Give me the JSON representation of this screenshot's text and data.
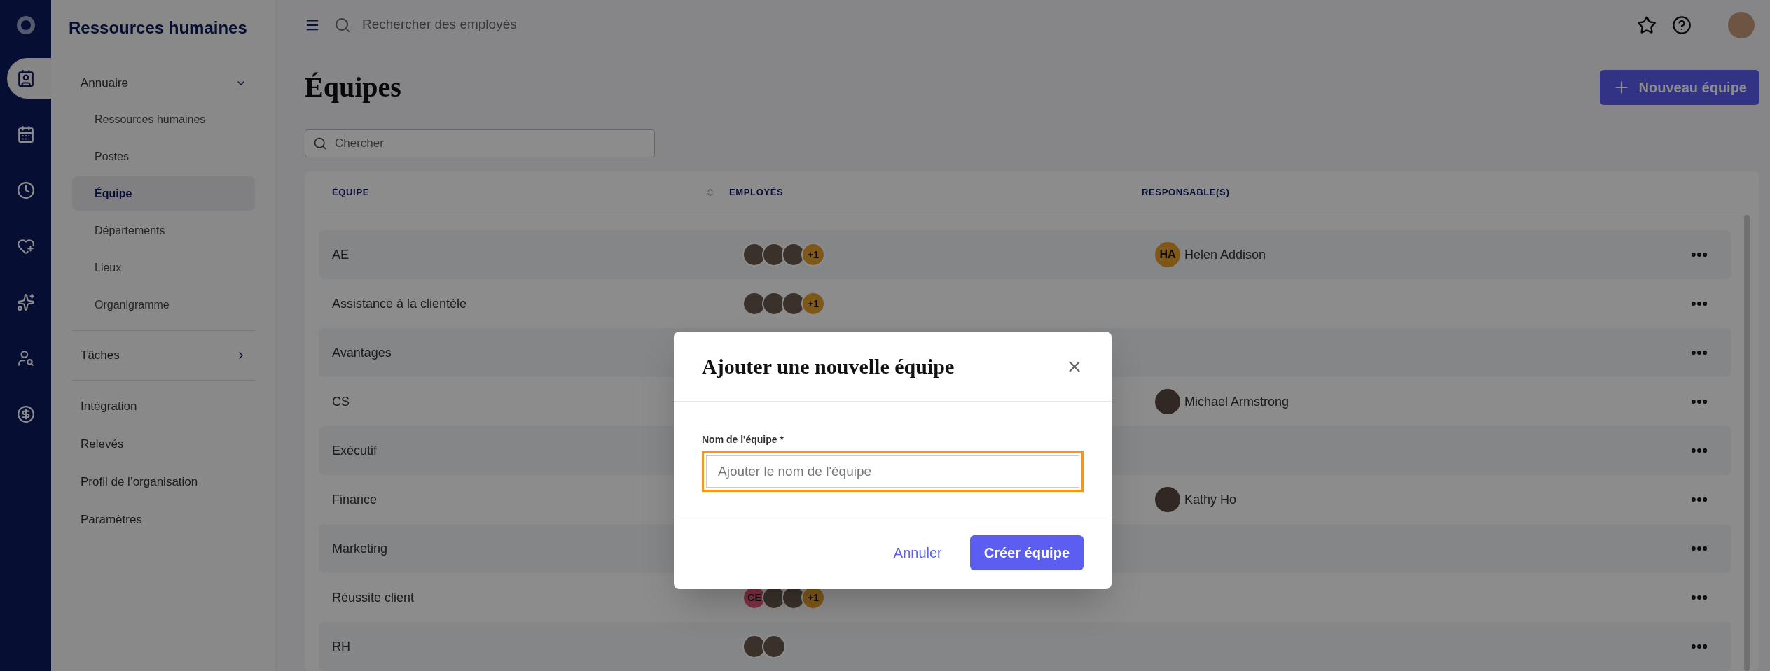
{
  "rail": [
    {
      "kind": "logo",
      "selected": false
    },
    {
      "kind": "directory",
      "selected": true
    },
    {
      "kind": "calendar",
      "selected": false
    },
    {
      "kind": "clock",
      "selected": false
    },
    {
      "kind": "wellness",
      "selected": false
    },
    {
      "kind": "star",
      "selected": false
    },
    {
      "kind": "person-search",
      "selected": false
    },
    {
      "kind": "money",
      "selected": false
    }
  ],
  "sidebar": {
    "title": "Ressources humaines",
    "items": [
      {
        "label": "Annuaire",
        "expanded": true,
        "children": [
          {
            "label": "Ressources humaines",
            "selected": false
          },
          {
            "label": "Postes",
            "selected": false
          },
          {
            "label": "Équipe",
            "selected": true
          },
          {
            "label": "Départements",
            "selected": false
          },
          {
            "label": "Lieux",
            "selected": false
          },
          {
            "label": "Organigramme",
            "selected": false
          }
        ]
      },
      {
        "label": "Tâches",
        "expanded": false
      },
      {
        "label": "Intégration"
      },
      {
        "label": "Relevés"
      },
      {
        "label": "Profil de l’organisation"
      },
      {
        "label": "Paramètres"
      }
    ]
  },
  "topbar": {
    "search_placeholder": "Rechercher des employés"
  },
  "page": {
    "title": "Équipes",
    "new_button": "Nouveau équipe",
    "search_placeholder": "Chercher"
  },
  "table": {
    "columns": [
      "ÉQUIPE",
      "EMPLOYÉS",
      "RESPONSABLE(S)"
    ],
    "rows": [
      {
        "team": "AE",
        "employees": [
          {
            "kind": "photo"
          },
          {
            "kind": "photo"
          },
          {
            "kind": "photo"
          },
          {
            "kind": "count",
            "text": "+1"
          }
        ],
        "manager": {
          "kind": "initials",
          "initials": "HA",
          "name": "Helen Addison"
        }
      },
      {
        "team": "Assistance à la clientèle",
        "employees": [
          {
            "kind": "photo"
          },
          {
            "kind": "photo"
          },
          {
            "kind": "photo"
          },
          {
            "kind": "count",
            "text": "+1"
          }
        ]
      },
      {
        "team": "Avantages",
        "employees": []
      },
      {
        "team": "CS",
        "employees": [],
        "manager": {
          "kind": "photo",
          "name": "Michael Armstrong"
        }
      },
      {
        "team": "Exécutif",
        "employees": []
      },
      {
        "team": "Finance",
        "employees": [],
        "manager": {
          "kind": "photo",
          "name": "Kathy Ho"
        }
      },
      {
        "team": "Marketing",
        "employees": []
      },
      {
        "team": "Réussite client",
        "employees": [
          {
            "kind": "initials",
            "text": "CE"
          },
          {
            "kind": "photo"
          },
          {
            "kind": "photo"
          },
          {
            "kind": "count",
            "text": "+1"
          }
        ]
      },
      {
        "team": "RH",
        "employees": [
          {
            "kind": "photo"
          },
          {
            "kind": "photo"
          }
        ]
      }
    ]
  },
  "modal": {
    "title": "Ajouter une nouvelle équipe",
    "field_label": "Nom de l'équipe *",
    "field_placeholder": "Ajouter le nom de l'équipe",
    "cancel": "Annuler",
    "submit": "Créer équipe"
  }
}
